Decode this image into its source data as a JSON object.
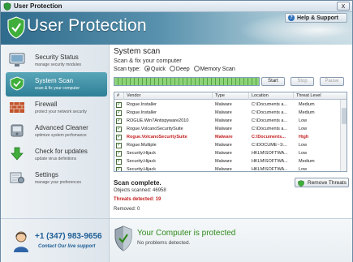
{
  "window": {
    "title": "User Protection",
    "close_label": "x"
  },
  "header": {
    "brand": "User Protection",
    "help_label": "Help & Support"
  },
  "sidebar": {
    "items": [
      {
        "title": "Security Status",
        "subtitle": "manage security modules",
        "icon": "security-status-icon"
      },
      {
        "title": "System Scan",
        "subtitle": "scan & fix your computer",
        "icon": "system-scan-icon",
        "active": true
      },
      {
        "title": "Firewall",
        "subtitle": "protect your network security",
        "icon": "firewall-icon"
      },
      {
        "title": "Advanced Cleaner",
        "subtitle": "optimize system perfomance",
        "icon": "cleaner-icon"
      },
      {
        "title": "Check for updates",
        "subtitle": "update virus definitions",
        "icon": "update-icon"
      },
      {
        "title": "Settings",
        "subtitle": "manage your preferences",
        "icon": "settings-icon"
      }
    ],
    "support": {
      "phone": "+1 (347) 983-9656",
      "contact": "Contact Our live support"
    }
  },
  "main": {
    "title": "System scan",
    "subtitle": "Scan & fix your computer",
    "scan_type_label": "Scan type:",
    "scan_types": [
      "Quick",
      "Deep",
      "Memory Scan"
    ],
    "selected_scan_type": "Quick",
    "progress": 1.0,
    "buttons": {
      "start": "Start",
      "stop": "Stop",
      "pause": "Pause"
    },
    "table": {
      "headers": [
        "#",
        "Vendor",
        "Type",
        "Location",
        "Threat Level"
      ],
      "rows": [
        {
          "vendor": "Rogue.Installer",
          "type": "Malware",
          "location": "C:\\Documents a...",
          "level": "Medium",
          "red": false
        },
        {
          "vendor": "Rogue.Installer",
          "type": "Malware",
          "location": "C:\\Documents a...",
          "level": "Medium",
          "red": false
        },
        {
          "vendor": "ROGUE.Win7Antispyware2010",
          "type": "Malware",
          "location": "C:\\Documents a...",
          "level": "Low",
          "red": false
        },
        {
          "vendor": "Rogue.VolcanoSecuritySuite",
          "type": "Malware",
          "location": "C:\\Documents a...",
          "level": "Low",
          "red": false
        },
        {
          "vendor": "Rogue.VolcanoSecuritySuite",
          "type": "Malware",
          "location": "C:\\Documents...",
          "level": "High",
          "red": true
        },
        {
          "vendor": "Rogue.Multiple",
          "type": "Malware",
          "location": "C:\\DOCUME~1\\...",
          "level": "Low",
          "red": false
        },
        {
          "vendor": "Security.Hijack",
          "type": "Malware",
          "location": "HKLM\\SOFTWA...",
          "level": "Low",
          "red": false
        },
        {
          "vendor": "Security.Hijack",
          "type": "Malware",
          "location": "HKLM\\SOFTWA...",
          "level": "Medium",
          "red": false
        },
        {
          "vendor": "Security.Hijack",
          "type": "Malware",
          "location": "HKLM\\SOFTWA...",
          "level": "Low",
          "red": false
        },
        {
          "vendor": "Security.Hijack",
          "type": "Malware",
          "location": "HKLM\\SOFTWA...",
          "level": "High",
          "red": true
        }
      ]
    },
    "scan_complete": "Scan complete.",
    "objects_scanned": "Objects scanned: 46958",
    "threats_detected": "Threats detected: 19",
    "removed": "Removed: 0",
    "remove_button": "Remove Threats",
    "protected_title": "Your Computer is protected",
    "protected_sub": "No problems detected."
  }
}
